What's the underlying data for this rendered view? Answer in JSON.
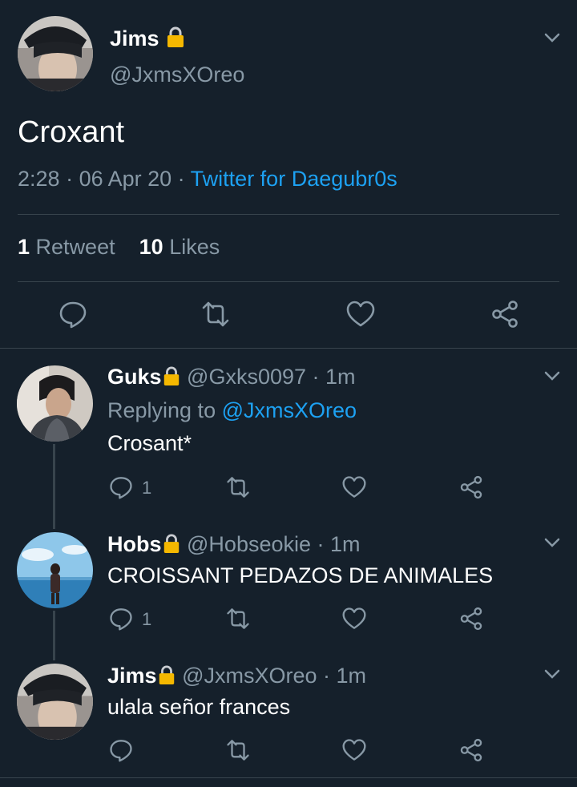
{
  "main_tweet": {
    "name": "Jims",
    "handle": "@JxmsXOreo",
    "text": "Croxant",
    "time": "2:28",
    "date": "06 Apr 20",
    "source": "Twitter for Daegubr0s",
    "retweet_count": "1",
    "retweet_label": "Retweet",
    "like_count": "10",
    "like_label": "Likes"
  },
  "replies": [
    {
      "name": "Guks",
      "handle": "@Gxks0097",
      "time": "1m",
      "replying_label": "Replying to",
      "replying_to": "@JxmsXOreo",
      "text": "Crosant*",
      "reply_count": "1"
    },
    {
      "name": "Hobs",
      "handle": "@Hobseokie",
      "time": "1m",
      "text": "CROISSANT PEDAZOS DE ANIMALES",
      "reply_count": "1"
    },
    {
      "name": "Jims",
      "handle": "@JxmsXOreo",
      "time": "1m",
      "text": "ulala señor frances"
    }
  ],
  "separator": " · ",
  "colors": {
    "background": "#15202b",
    "text_secondary": "#8899a6",
    "accent": "#1da1f2",
    "divider": "#38444d",
    "lock": "#f5b800"
  },
  "icons": [
    "lock-icon",
    "chevron-down-icon",
    "reply-icon",
    "retweet-icon",
    "like-icon",
    "share-icon"
  ]
}
